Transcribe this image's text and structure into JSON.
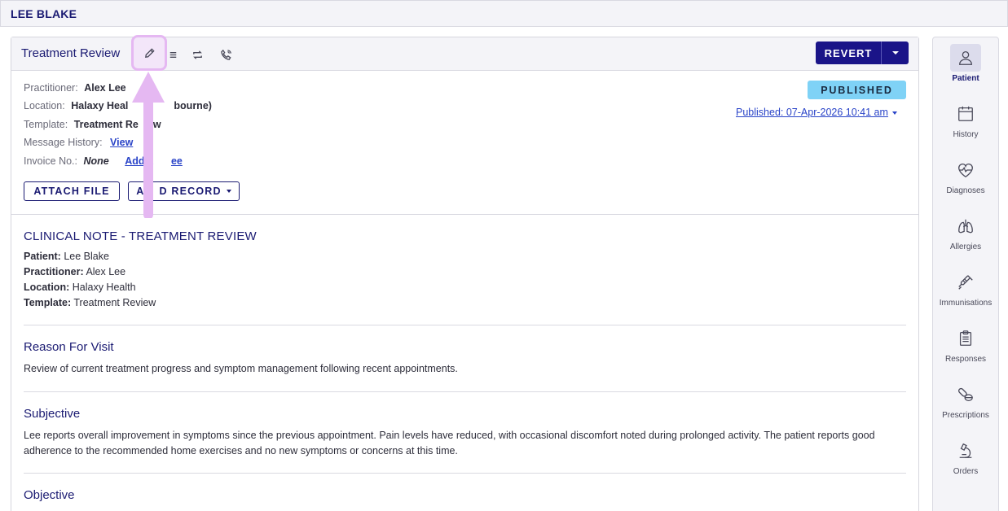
{
  "patient_header": {
    "name": "LEE BLAKE"
  },
  "card": {
    "title": "Treatment Review",
    "revert_label": "REVERT",
    "status_badge": "PUBLISHED",
    "published_text": "Published: 07-Apr-2026 10:41 am",
    "meta": {
      "practitioner_label": "Practitioner:",
      "practitioner_value": "Alex Lee",
      "location_label": "Location:",
      "location_value": "Halaxy Heal",
      "location_value_end": "bourne)",
      "template_label": "Template:",
      "template_value": "Treatment Re",
      "template_value_end": "w",
      "message_history_label": "Message History:",
      "message_history_link": "View",
      "invoice_label": "Invoice No.:",
      "invoice_value": "None",
      "add_fee_link": "Add a",
      "add_fee_link_end": "ee"
    },
    "buttons": {
      "attach_file": "ATTACH FILE",
      "add_record": "A",
      "add_record_end": "D RECORD"
    }
  },
  "note": {
    "heading": "CLINICAL NOTE - TREATMENT REVIEW",
    "summary": [
      {
        "label": "Patient:",
        "value": "Lee Blake"
      },
      {
        "label": "Practitioner:",
        "value": "Alex Lee"
      },
      {
        "label": "Location:",
        "value": "Halaxy Health"
      },
      {
        "label": "Template:",
        "value": "Treatment Review"
      }
    ],
    "sections": [
      {
        "heading": "Reason For Visit",
        "body": "Review of current treatment progress and symptom management following recent appointments."
      },
      {
        "heading": "Subjective",
        "body": "Lee reports overall improvement in symptoms since the previous appointment. Pain levels have reduced, with occasional discomfort noted during prolonged activity. The patient reports good adherence to the recommended home exercises and no new symptoms or concerns at this time."
      },
      {
        "heading": "Objective",
        "body": ""
      }
    ]
  },
  "sidebar": {
    "items": [
      {
        "label": "Patient",
        "icon": "person-icon"
      },
      {
        "label": "History",
        "icon": "calendar-icon"
      },
      {
        "label": "Diagnoses",
        "icon": "heart-pulse-icon"
      },
      {
        "label": "Allergies",
        "icon": "lungs-icon"
      },
      {
        "label": "Immunisations",
        "icon": "syringe-icon"
      },
      {
        "label": "Responses",
        "icon": "clipboard-icon"
      },
      {
        "label": "Prescriptions",
        "icon": "pills-icon"
      },
      {
        "label": "Orders",
        "icon": "microscope-icon"
      }
    ]
  },
  "colors": {
    "brand": "#1a1488",
    "heading": "#1a1a72",
    "badge": "#7fd2f6",
    "link": "#2a44c8",
    "highlight": "#e5b8f2"
  }
}
